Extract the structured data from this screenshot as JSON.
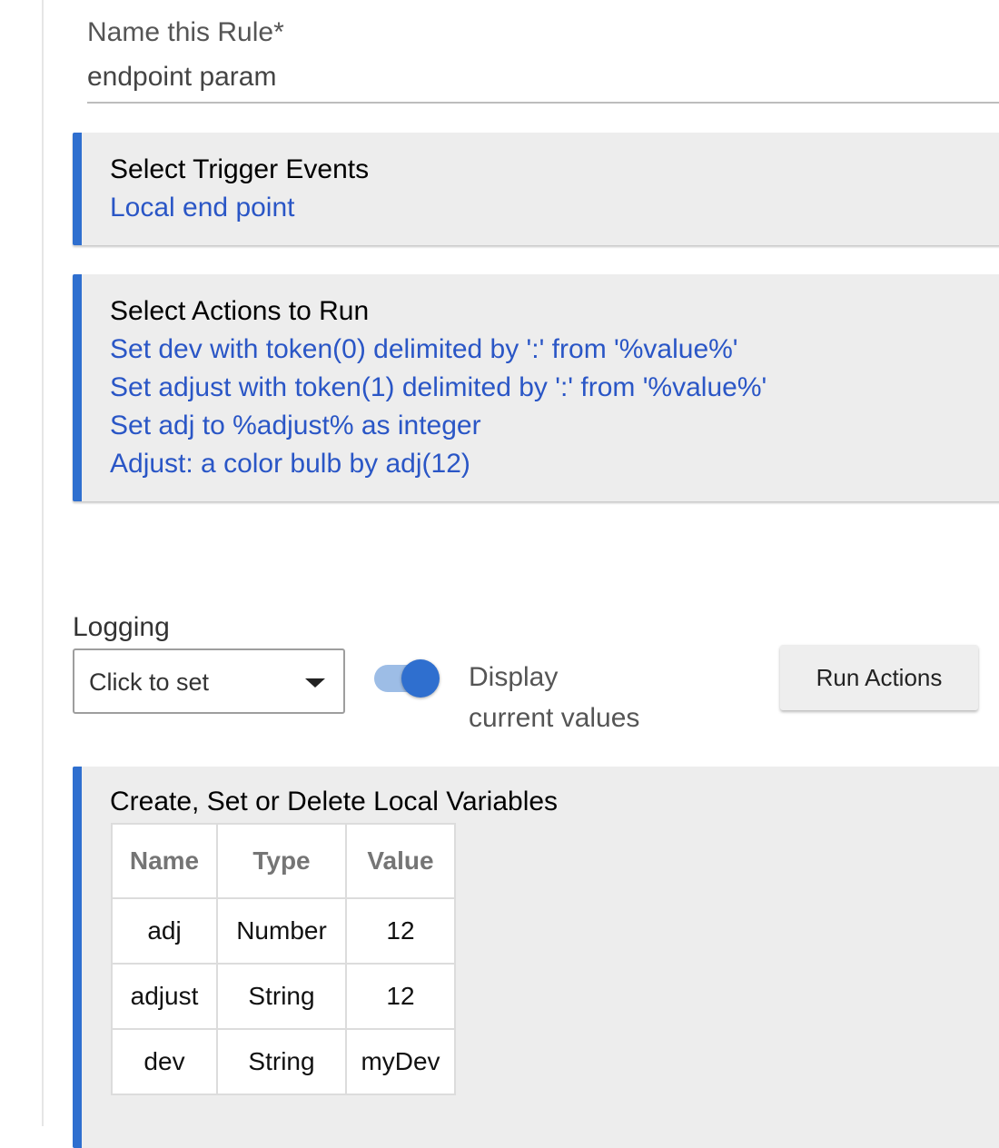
{
  "rule_name": {
    "label": "Name this Rule*",
    "value": "endpoint param"
  },
  "trigger_panel": {
    "title": "Select Trigger Events",
    "items": [
      "Local end point"
    ]
  },
  "actions_panel": {
    "title": "Select Actions to Run",
    "items": [
      "Set dev with token(0) delimited by ':' from '%value%'",
      "Set adjust with token(1) delimited by ':' from '%value%'",
      "Set adj to %adjust% as integer",
      "Adjust: a color bulb by adj(12)"
    ]
  },
  "logging": {
    "label": "Logging",
    "selected": "Click to set"
  },
  "display_toggle": {
    "on": true,
    "label_line1": "Display",
    "label_line2": "current values"
  },
  "run_button": {
    "label": "Run Actions"
  },
  "variables_panel": {
    "title": "Create, Set or Delete Local Variables",
    "headers": [
      "Name",
      "Type",
      "Value"
    ],
    "rows": [
      [
        "adj",
        "Number",
        "12"
      ],
      [
        "adjust",
        "String",
        "12"
      ],
      [
        "dev",
        "String",
        "myDev"
      ]
    ]
  },
  "colors": {
    "accent": "#2f6fcf",
    "link": "#2a56c6",
    "panel_bg": "#ededed"
  }
}
